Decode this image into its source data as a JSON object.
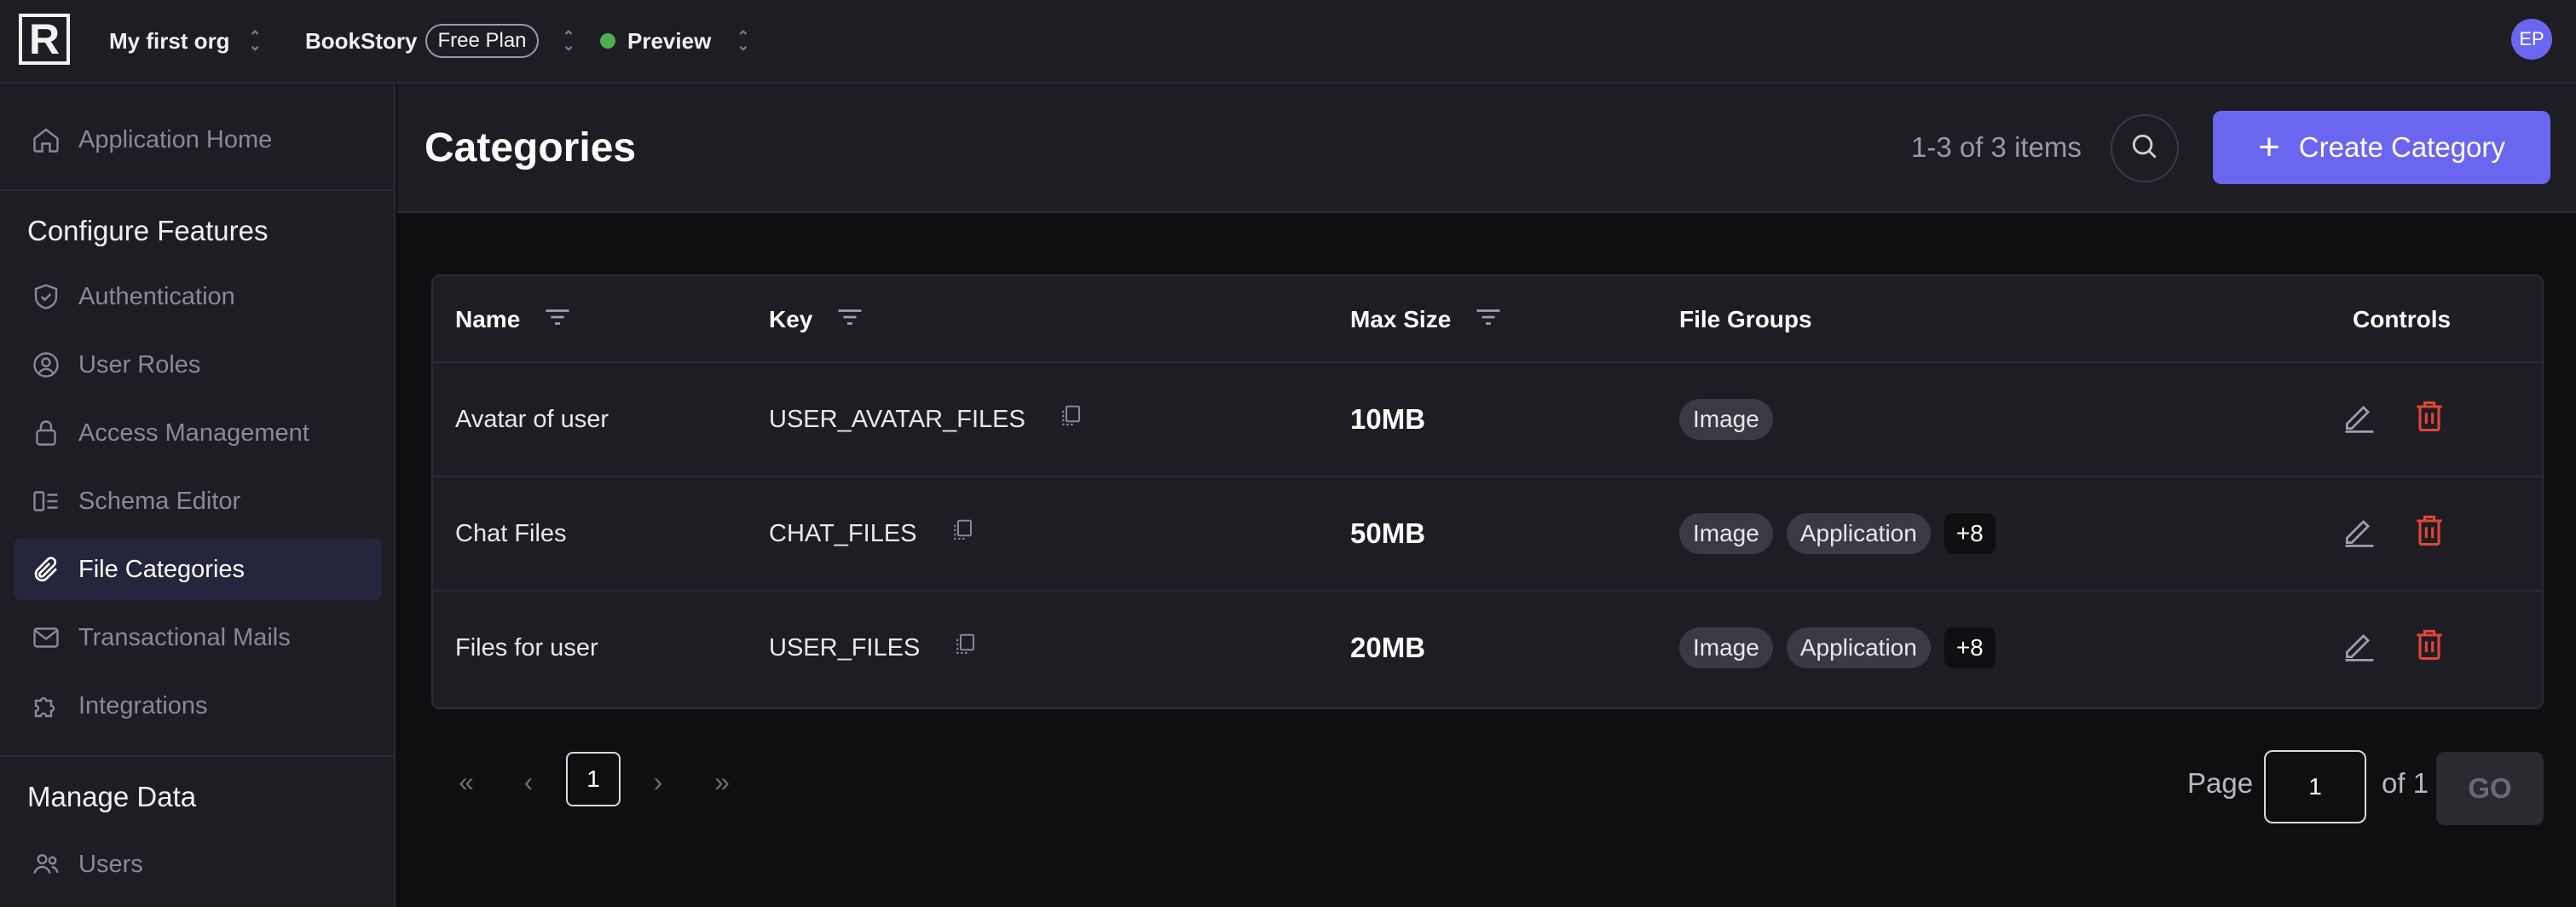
{
  "topbar": {
    "org": "My first org",
    "app": "BookStory",
    "plan": "Free Plan",
    "env": "Preview",
    "user_initials": "EP"
  },
  "sidebar": {
    "home_label": "Application Home",
    "configure_title": "Configure Features",
    "configure_items": [
      {
        "label": "Authentication",
        "icon": "shield-icon"
      },
      {
        "label": "User Roles",
        "icon": "user-circle-icon"
      },
      {
        "label": "Access Management",
        "icon": "lock-icon"
      },
      {
        "label": "Schema Editor",
        "icon": "schema-icon"
      },
      {
        "label": "File Categories",
        "icon": "paperclip-icon",
        "active": true
      },
      {
        "label": "Transactional Mails",
        "icon": "mail-icon"
      },
      {
        "label": "Integrations",
        "icon": "puzzle-icon"
      }
    ],
    "manage_title": "Manage Data",
    "manage_items": [
      {
        "label": "Users",
        "icon": "users-icon"
      }
    ]
  },
  "header": {
    "title": "Categories",
    "count": "1-3 of 3 items",
    "create_label": "Create Category"
  },
  "table": {
    "columns": [
      "Name",
      "Key",
      "Max Size",
      "File Groups",
      "Controls"
    ],
    "rows": [
      {
        "name": "Avatar of user",
        "key": "USER_AVATAR_FILES",
        "max_size": "10MB",
        "groups": [
          "Image"
        ],
        "more": ""
      },
      {
        "name": "Chat Files",
        "key": "CHAT_FILES",
        "max_size": "50MB",
        "groups": [
          "Image",
          "Application"
        ],
        "more": "+8"
      },
      {
        "name": "Files for user",
        "key": "USER_FILES",
        "max_size": "20MB",
        "groups": [
          "Image",
          "Application"
        ],
        "more": "+8"
      }
    ]
  },
  "pagination": {
    "current_page": "1",
    "page_label": "Page",
    "page_input_value": "1",
    "of_label": "of 1",
    "go_label": "GO"
  },
  "colors": {
    "accent": "#6b66f0",
    "danger": "#e0453a",
    "status_green": "#4caf50"
  }
}
